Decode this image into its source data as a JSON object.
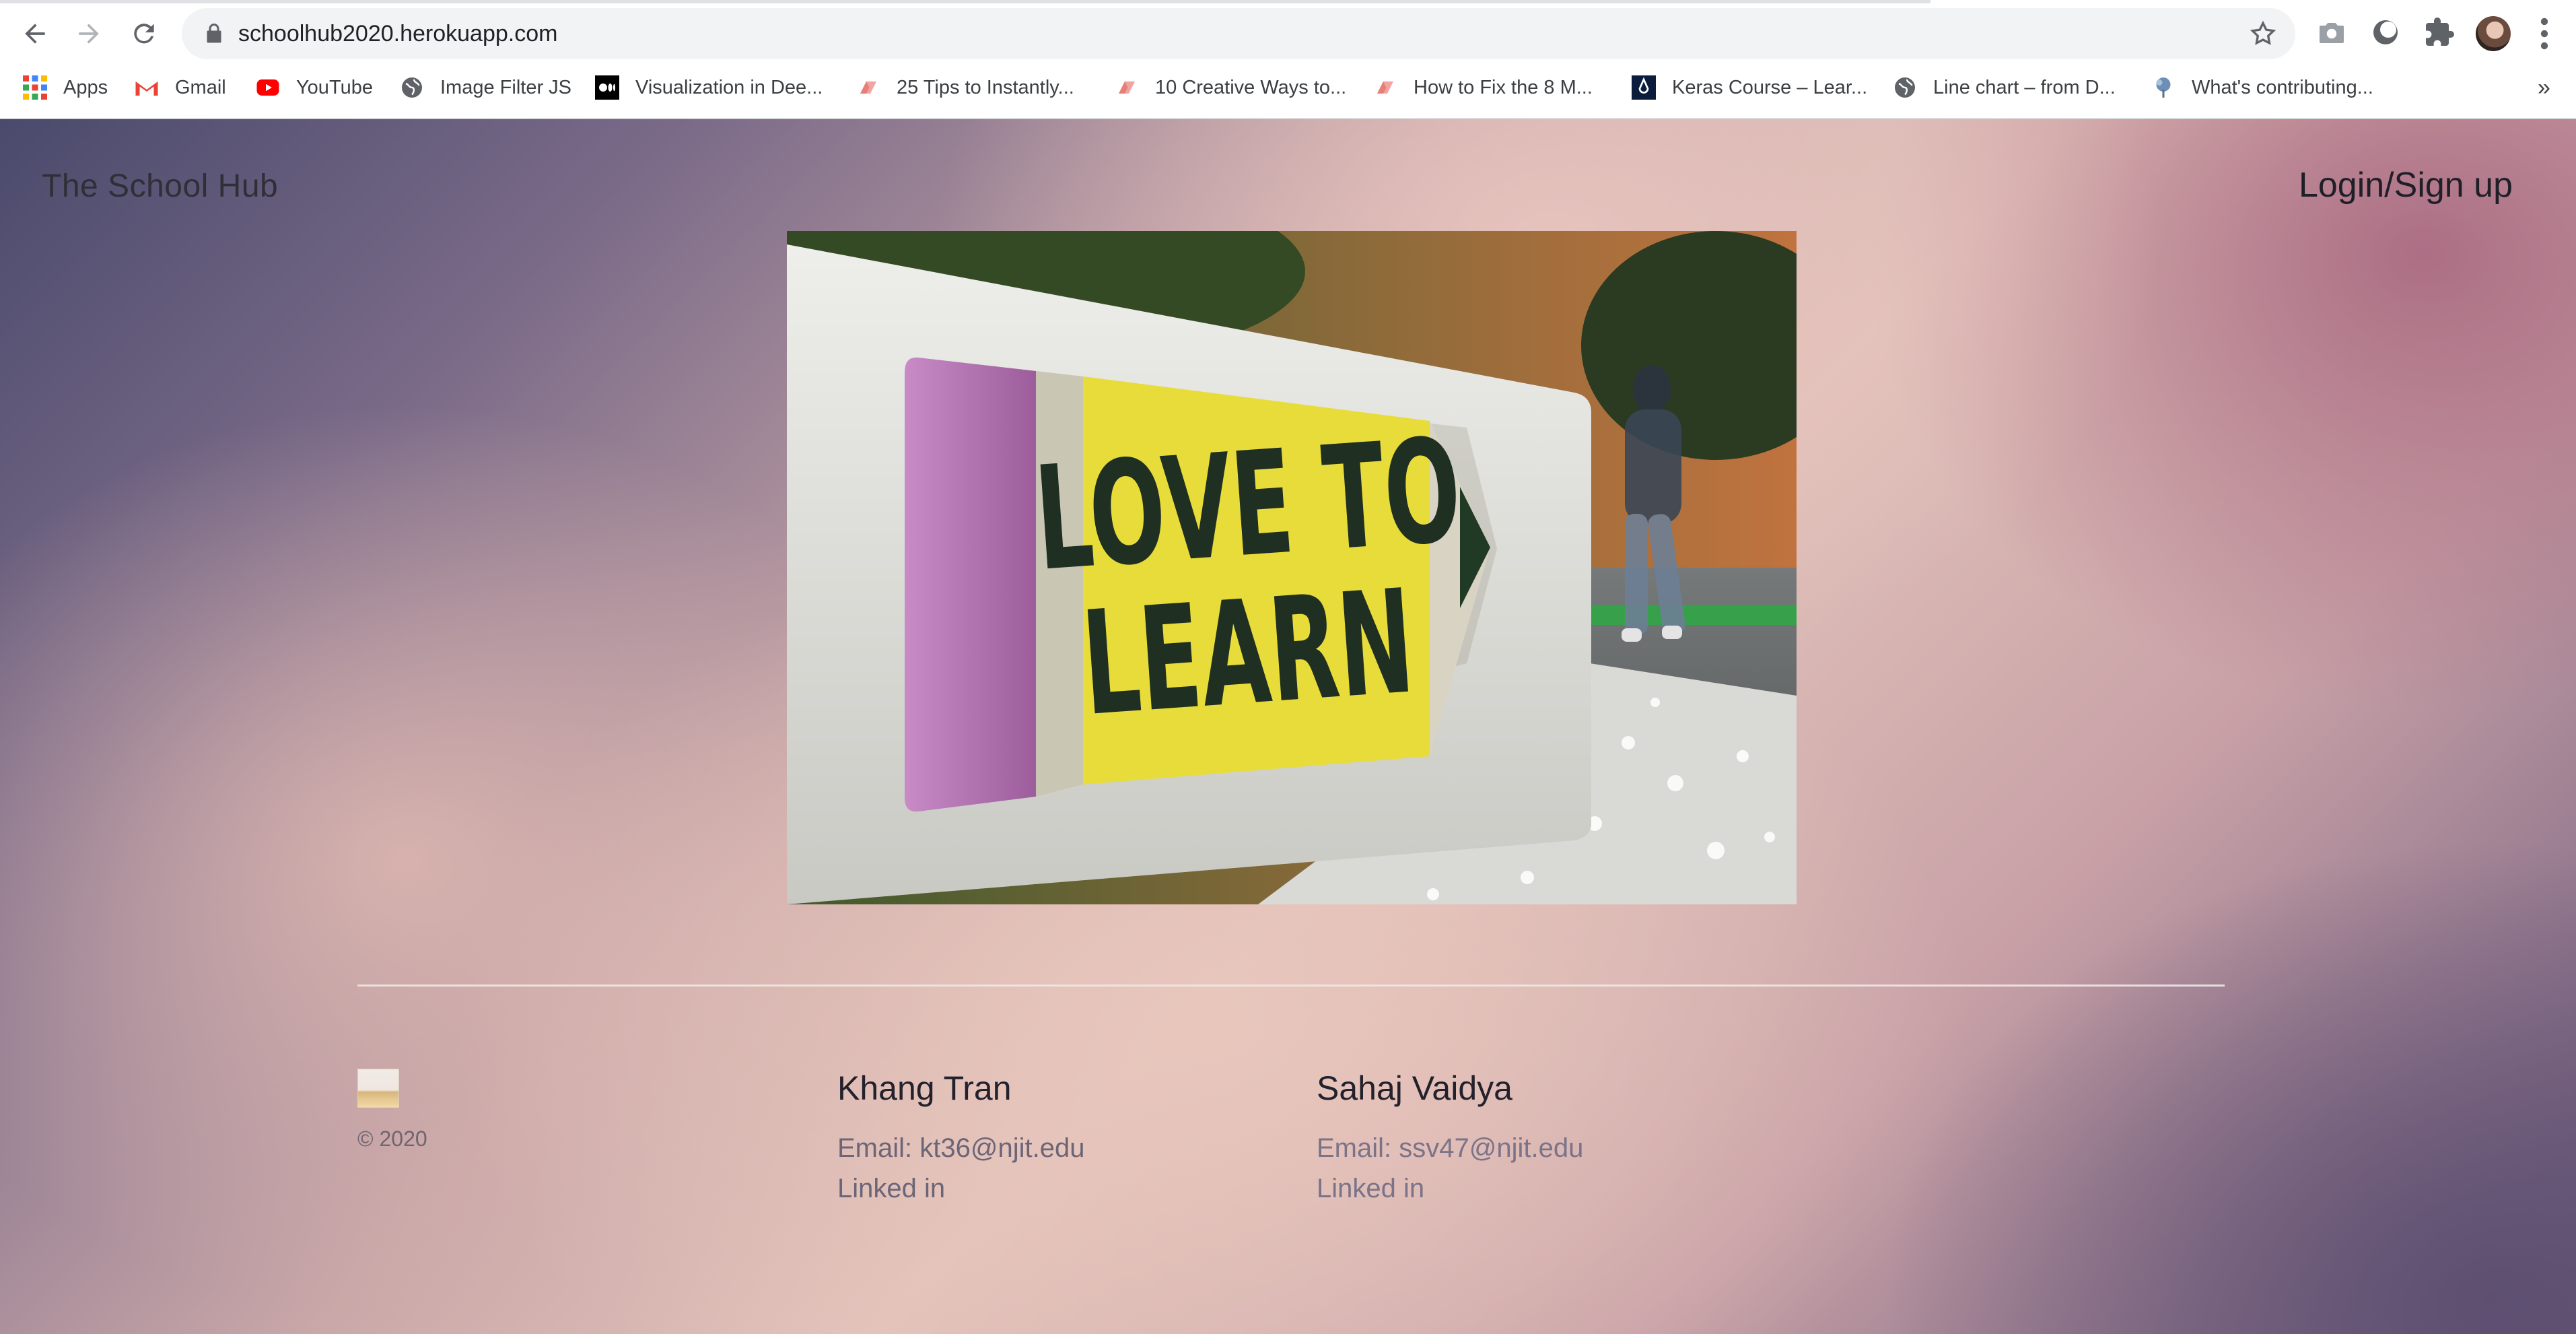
{
  "browser": {
    "url": "schoolhub2020.herokuapp.com",
    "bookmarks": [
      {
        "label": "Apps",
        "icon": "apps-grid-icon"
      },
      {
        "label": "Gmail",
        "icon": "gmail-icon"
      },
      {
        "label": "YouTube",
        "icon": "youtube-icon"
      },
      {
        "label": "Image Filter JS",
        "icon": "globe-icon"
      },
      {
        "label": "Visualization in Dee...",
        "icon": "medium-icon"
      },
      {
        "label": "25 Tips to Instantly...",
        "icon": "bookmark-site-icon"
      },
      {
        "label": "10 Creative Ways to...",
        "icon": "bookmark-site-icon"
      },
      {
        "label": "How to Fix the 8 M...",
        "icon": "bookmark-site-icon"
      },
      {
        "label": "Keras Course – Lear...",
        "icon": "keras-icon"
      },
      {
        "label": "Line chart – from D...",
        "icon": "globe-icon"
      },
      {
        "label": "What's contributing...",
        "icon": "tree-icon"
      }
    ],
    "more_bookmarks": "»"
  },
  "header": {
    "brand": "The School Hub",
    "login_label": "Login/Sign up"
  },
  "hero": {
    "sign_text_line1": "LOVE TO",
    "sign_text_line2": "LEARN"
  },
  "footer": {
    "copyright": "© 2020",
    "contacts": [
      {
        "name": "Khang Tran",
        "email": "Email: kt36@njit.edu",
        "linkedin": "Linked in"
      },
      {
        "name": "Sahaj Vaidya",
        "email": "Email: ssv47@njit.edu",
        "linkedin": "Linked in"
      }
    ]
  }
}
